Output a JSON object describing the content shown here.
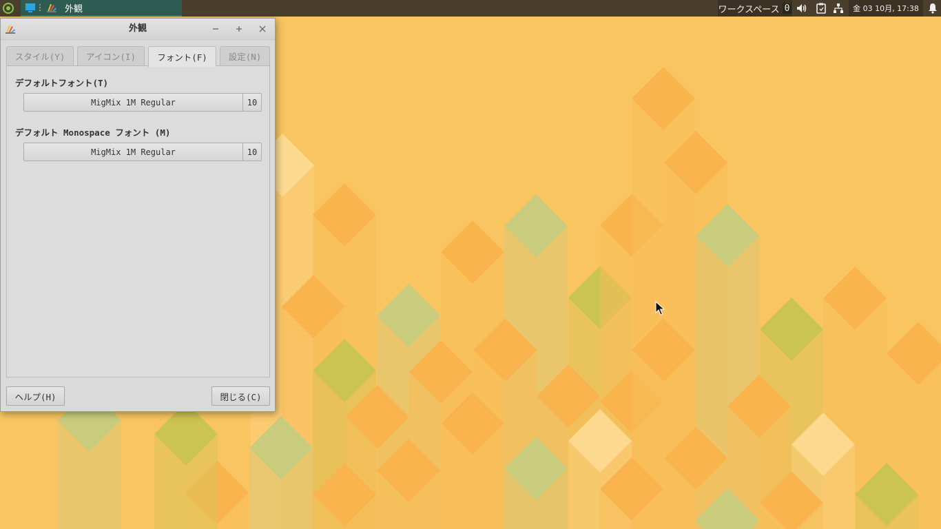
{
  "panel": {
    "task_title": "外観",
    "workspace_label": "ワークスペース",
    "workspace_number": "0",
    "clock": "金 03 10月, 17:38",
    "icons": [
      "distro-menu-icon",
      "show-desktop-icon",
      "appearance-app-icon",
      "volume-icon",
      "clipboard-icon",
      "network-icon",
      "notification-bell-icon"
    ]
  },
  "window": {
    "title": "外観",
    "controls": [
      "minimize-icon",
      "maximize-icon",
      "close-icon"
    ],
    "tabs": [
      {
        "label": "スタイル(Y)"
      },
      {
        "label": "アイコン(I)"
      },
      {
        "label": "フォント(F)"
      },
      {
        "label": "設定(N)"
      }
    ],
    "active_tab": "フォント(F)",
    "default_font": {
      "label": "デフォルトフォント(T)",
      "font_name": "MigMix 1M Regular",
      "font_size": "10"
    },
    "monospace_font": {
      "label": "デフォルト Monospace フォント (M)",
      "font_name": "MigMix 1M Regular",
      "font_size": "10"
    },
    "help_button": "ヘルプ(H)",
    "close_button": "閉じる(C)"
  },
  "colors": {
    "panel_bg": "#4a3f2d",
    "task_active_bg": "#2e5b52",
    "wallpaper_base": "#f6c25e",
    "window_bg": "#dadada"
  }
}
